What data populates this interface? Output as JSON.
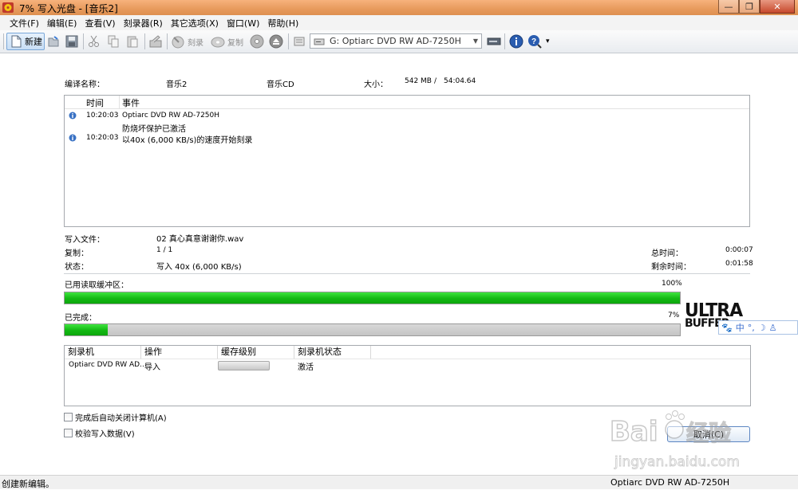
{
  "window": {
    "title": "7% 写入光盘 - [音乐2]",
    "controls": [
      "minimize",
      "restore",
      "close"
    ]
  },
  "menu": [
    "文件(F)",
    "编辑(E)",
    "查看(V)",
    "刻录器(R)",
    "其它选项(X)",
    "窗口(W)",
    "帮助(H)"
  ],
  "toolbar": {
    "new_label": "新建",
    "burn_label": "刻录",
    "copy_label": "复制",
    "drive": "G: Optiarc DVD RW AD-7250H"
  },
  "info": {
    "compile_name_label": "编译名称：",
    "compile_name": "音乐2",
    "type": "音乐CD",
    "size_label": "大小：",
    "size": "542 MB",
    "size_sep": "/",
    "duration": "54:04.64"
  },
  "log": {
    "col_time": "时间",
    "col_event": "事件",
    "entries": [
      {
        "time": "10:20:03",
        "line1": "Optiarc DVD RW AD-7250H",
        "line2": "防烧坏保护已激活"
      },
      {
        "time": "10:20:03",
        "line1": "以40x (6,000 KB/s)的速度开始刻录",
        "line2": ""
      }
    ]
  },
  "status": {
    "writing_file_label": "写入文件：",
    "writing_file": "02 真心真意谢谢你.wav",
    "copies_label": "复制：",
    "copies": "1 / 1",
    "state_label": "状态：",
    "state": "写入 40x (6,000 KB/s)",
    "total_time_label": "总时间：",
    "total_time": "0:00:07",
    "remaining_label": "剩余时间：",
    "remaining": "0:01:58"
  },
  "progress": {
    "buffer_label": "已用读取缓冲区：",
    "buffer_pct_text": "100%",
    "buffer_fraction": 1.0,
    "done_label": "已完成：",
    "done_pct_text": "7%",
    "done_fraction": 0.07
  },
  "logo_text": "ULTRA BUFFER",
  "ime_bar": [
    "中",
    "°,",
    "☽",
    "⚲"
  ],
  "recorders": {
    "col_recorder": "刻录机",
    "col_action": "操作",
    "col_buffer": "缓存级别",
    "col_state": "刻录机状态",
    "rows": [
      {
        "recorder": "Optiarc DVD RW AD...",
        "action": "导入",
        "buffer_fraction": 0,
        "state": "激活"
      }
    ]
  },
  "options": {
    "shutdown_label": "完成后自动关闭计算机(A)",
    "shutdown_checked": false,
    "verify_label": "校验写入数据(V)",
    "verify_checked": false
  },
  "cancel_label": "取消(C)",
  "watermark": {
    "brand": "Baidu经验",
    "url": "jingyan.baidu.com"
  },
  "statusbar": {
    "left": "创建新编辑。",
    "right": "Optiarc  DVD RW AD-7250H"
  },
  "colors": {
    "progress_green": "#13b813",
    "titlebar": "#e79a5c"
  }
}
